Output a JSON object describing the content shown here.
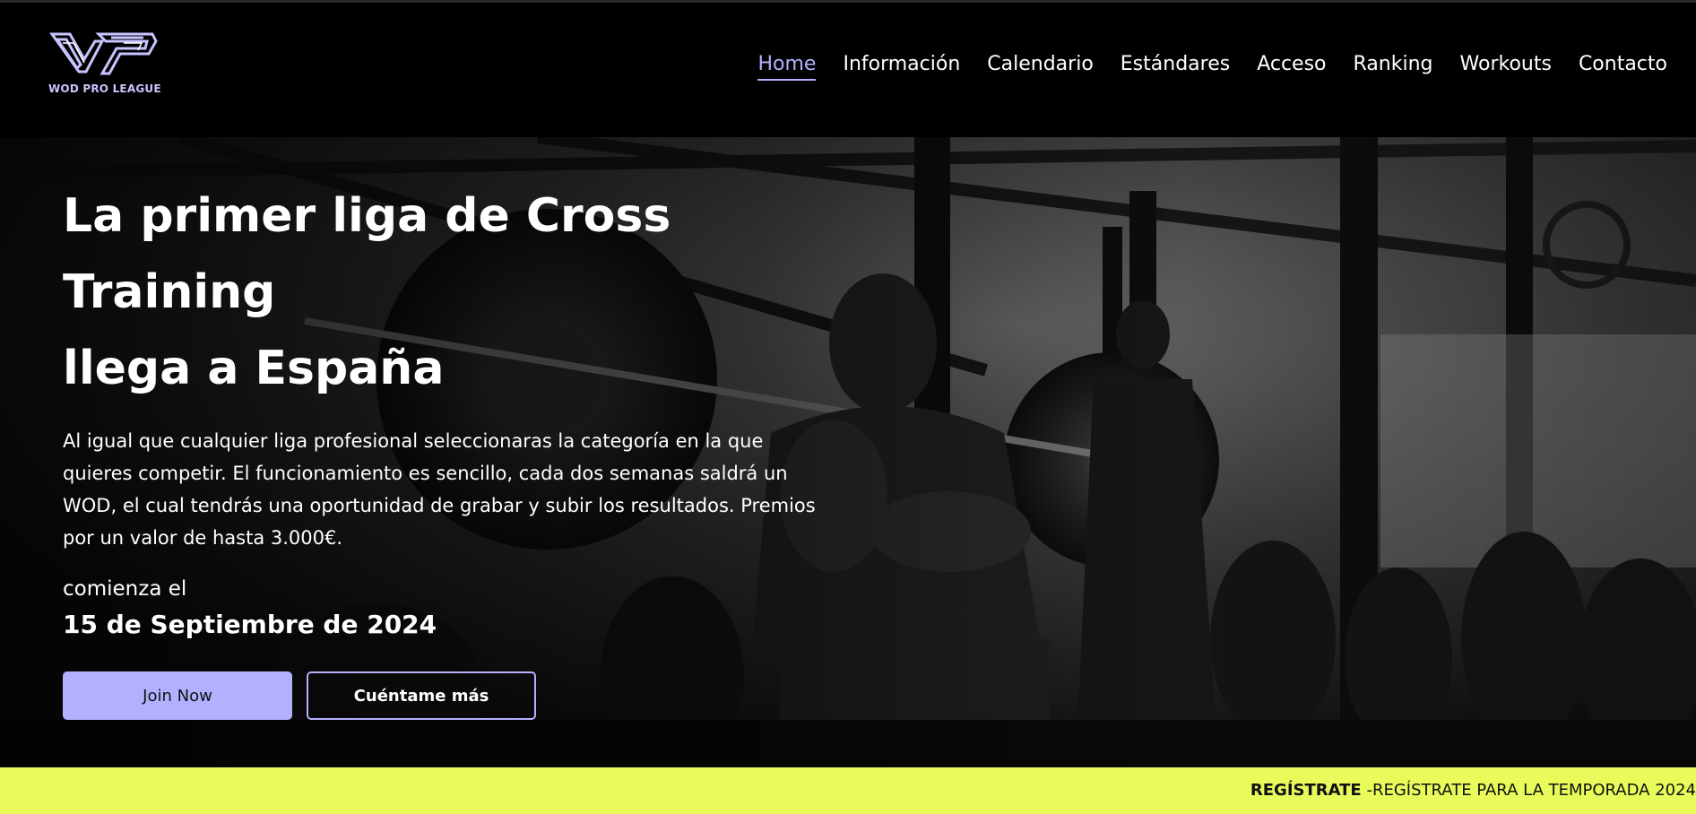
{
  "logo": {
    "text": "WOD PRO LEAGUE",
    "icon": "wp-logo-icon"
  },
  "nav": {
    "items": [
      {
        "label": "Home",
        "active": true
      },
      {
        "label": "Información",
        "active": false
      },
      {
        "label": "Calendario",
        "active": false
      },
      {
        "label": "Estándares",
        "active": false
      },
      {
        "label": "Acceso",
        "active": false
      },
      {
        "label": "Ranking",
        "active": false
      },
      {
        "label": "Workouts",
        "active": false
      },
      {
        "label": "Contacto",
        "active": false
      }
    ]
  },
  "hero": {
    "title_line1": "La primer liga de Cross Training",
    "title_line2": "llega a España",
    "description": "Al igual que cualquier liga profesional seleccionaras la categoría en la que quieres competir. El funcionamiento es sencillo, cada dos semanas saldrá un WOD, el cual tendrás una oportunidad de grabar y subir los resultados. Premios por un valor de hasta 3.000€.",
    "start_label": "comienza el",
    "start_date": "15 de Septiembre de 2024",
    "primary_button": "Join Now",
    "secondary_button": "Cuéntame más"
  },
  "marquee": {
    "strong": "REGÍSTRATE",
    "text": " -REGÍSTRATE PARA LA TEMPORADA 2024"
  },
  "colors": {
    "accent": "#b3b0ff",
    "marquee_bg": "#e8fb5a",
    "header_bg": "#000000"
  }
}
